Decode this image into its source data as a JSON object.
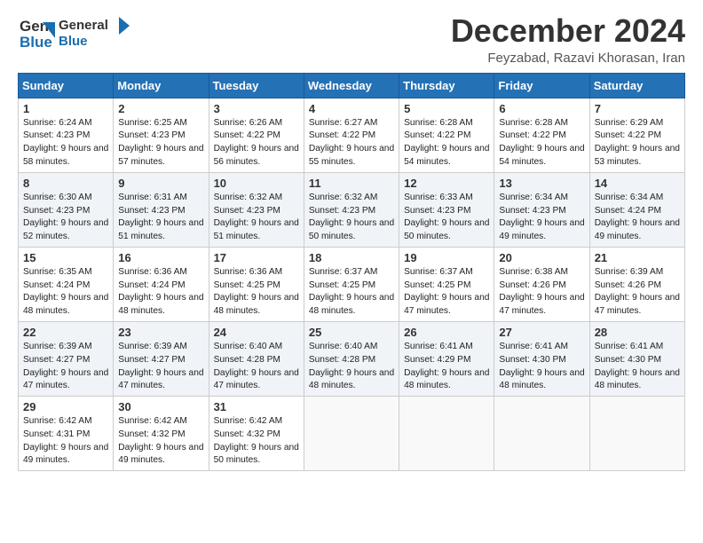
{
  "header": {
    "logo_general": "General",
    "logo_blue": "Blue",
    "month_title": "December 2024",
    "location": "Feyzabad, Razavi Khorasan, Iran"
  },
  "weekdays": [
    "Sunday",
    "Monday",
    "Tuesday",
    "Wednesday",
    "Thursday",
    "Friday",
    "Saturday"
  ],
  "weeks": [
    [
      {
        "day": "1",
        "sunrise": "Sunrise: 6:24 AM",
        "sunset": "Sunset: 4:23 PM",
        "daylight": "Daylight: 9 hours and 58 minutes."
      },
      {
        "day": "2",
        "sunrise": "Sunrise: 6:25 AM",
        "sunset": "Sunset: 4:23 PM",
        "daylight": "Daylight: 9 hours and 57 minutes."
      },
      {
        "day": "3",
        "sunrise": "Sunrise: 6:26 AM",
        "sunset": "Sunset: 4:22 PM",
        "daylight": "Daylight: 9 hours and 56 minutes."
      },
      {
        "day": "4",
        "sunrise": "Sunrise: 6:27 AM",
        "sunset": "Sunset: 4:22 PM",
        "daylight": "Daylight: 9 hours and 55 minutes."
      },
      {
        "day": "5",
        "sunrise": "Sunrise: 6:28 AM",
        "sunset": "Sunset: 4:22 PM",
        "daylight": "Daylight: 9 hours and 54 minutes."
      },
      {
        "day": "6",
        "sunrise": "Sunrise: 6:28 AM",
        "sunset": "Sunset: 4:22 PM",
        "daylight": "Daylight: 9 hours and 54 minutes."
      },
      {
        "day": "7",
        "sunrise": "Sunrise: 6:29 AM",
        "sunset": "Sunset: 4:22 PM",
        "daylight": "Daylight: 9 hours and 53 minutes."
      }
    ],
    [
      {
        "day": "8",
        "sunrise": "Sunrise: 6:30 AM",
        "sunset": "Sunset: 4:23 PM",
        "daylight": "Daylight: 9 hours and 52 minutes."
      },
      {
        "day": "9",
        "sunrise": "Sunrise: 6:31 AM",
        "sunset": "Sunset: 4:23 PM",
        "daylight": "Daylight: 9 hours and 51 minutes."
      },
      {
        "day": "10",
        "sunrise": "Sunrise: 6:32 AM",
        "sunset": "Sunset: 4:23 PM",
        "daylight": "Daylight: 9 hours and 51 minutes."
      },
      {
        "day": "11",
        "sunrise": "Sunrise: 6:32 AM",
        "sunset": "Sunset: 4:23 PM",
        "daylight": "Daylight: 9 hours and 50 minutes."
      },
      {
        "day": "12",
        "sunrise": "Sunrise: 6:33 AM",
        "sunset": "Sunset: 4:23 PM",
        "daylight": "Daylight: 9 hours and 50 minutes."
      },
      {
        "day": "13",
        "sunrise": "Sunrise: 6:34 AM",
        "sunset": "Sunset: 4:23 PM",
        "daylight": "Daylight: 9 hours and 49 minutes."
      },
      {
        "day": "14",
        "sunrise": "Sunrise: 6:34 AM",
        "sunset": "Sunset: 4:24 PM",
        "daylight": "Daylight: 9 hours and 49 minutes."
      }
    ],
    [
      {
        "day": "15",
        "sunrise": "Sunrise: 6:35 AM",
        "sunset": "Sunset: 4:24 PM",
        "daylight": "Daylight: 9 hours and 48 minutes."
      },
      {
        "day": "16",
        "sunrise": "Sunrise: 6:36 AM",
        "sunset": "Sunset: 4:24 PM",
        "daylight": "Daylight: 9 hours and 48 minutes."
      },
      {
        "day": "17",
        "sunrise": "Sunrise: 6:36 AM",
        "sunset": "Sunset: 4:25 PM",
        "daylight": "Daylight: 9 hours and 48 minutes."
      },
      {
        "day": "18",
        "sunrise": "Sunrise: 6:37 AM",
        "sunset": "Sunset: 4:25 PM",
        "daylight": "Daylight: 9 hours and 48 minutes."
      },
      {
        "day": "19",
        "sunrise": "Sunrise: 6:37 AM",
        "sunset": "Sunset: 4:25 PM",
        "daylight": "Daylight: 9 hours and 47 minutes."
      },
      {
        "day": "20",
        "sunrise": "Sunrise: 6:38 AM",
        "sunset": "Sunset: 4:26 PM",
        "daylight": "Daylight: 9 hours and 47 minutes."
      },
      {
        "day": "21",
        "sunrise": "Sunrise: 6:39 AM",
        "sunset": "Sunset: 4:26 PM",
        "daylight": "Daylight: 9 hours and 47 minutes."
      }
    ],
    [
      {
        "day": "22",
        "sunrise": "Sunrise: 6:39 AM",
        "sunset": "Sunset: 4:27 PM",
        "daylight": "Daylight: 9 hours and 47 minutes."
      },
      {
        "day": "23",
        "sunrise": "Sunrise: 6:39 AM",
        "sunset": "Sunset: 4:27 PM",
        "daylight": "Daylight: 9 hours and 47 minutes."
      },
      {
        "day": "24",
        "sunrise": "Sunrise: 6:40 AM",
        "sunset": "Sunset: 4:28 PM",
        "daylight": "Daylight: 9 hours and 47 minutes."
      },
      {
        "day": "25",
        "sunrise": "Sunrise: 6:40 AM",
        "sunset": "Sunset: 4:28 PM",
        "daylight": "Daylight: 9 hours and 48 minutes."
      },
      {
        "day": "26",
        "sunrise": "Sunrise: 6:41 AM",
        "sunset": "Sunset: 4:29 PM",
        "daylight": "Daylight: 9 hours and 48 minutes."
      },
      {
        "day": "27",
        "sunrise": "Sunrise: 6:41 AM",
        "sunset": "Sunset: 4:30 PM",
        "daylight": "Daylight: 9 hours and 48 minutes."
      },
      {
        "day": "28",
        "sunrise": "Sunrise: 6:41 AM",
        "sunset": "Sunset: 4:30 PM",
        "daylight": "Daylight: 9 hours and 48 minutes."
      }
    ],
    [
      {
        "day": "29",
        "sunrise": "Sunrise: 6:42 AM",
        "sunset": "Sunset: 4:31 PM",
        "daylight": "Daylight: 9 hours and 49 minutes."
      },
      {
        "day": "30",
        "sunrise": "Sunrise: 6:42 AM",
        "sunset": "Sunset: 4:32 PM",
        "daylight": "Daylight: 9 hours and 49 minutes."
      },
      {
        "day": "31",
        "sunrise": "Sunrise: 6:42 AM",
        "sunset": "Sunset: 4:32 PM",
        "daylight": "Daylight: 9 hours and 50 minutes."
      },
      null,
      null,
      null,
      null
    ]
  ]
}
